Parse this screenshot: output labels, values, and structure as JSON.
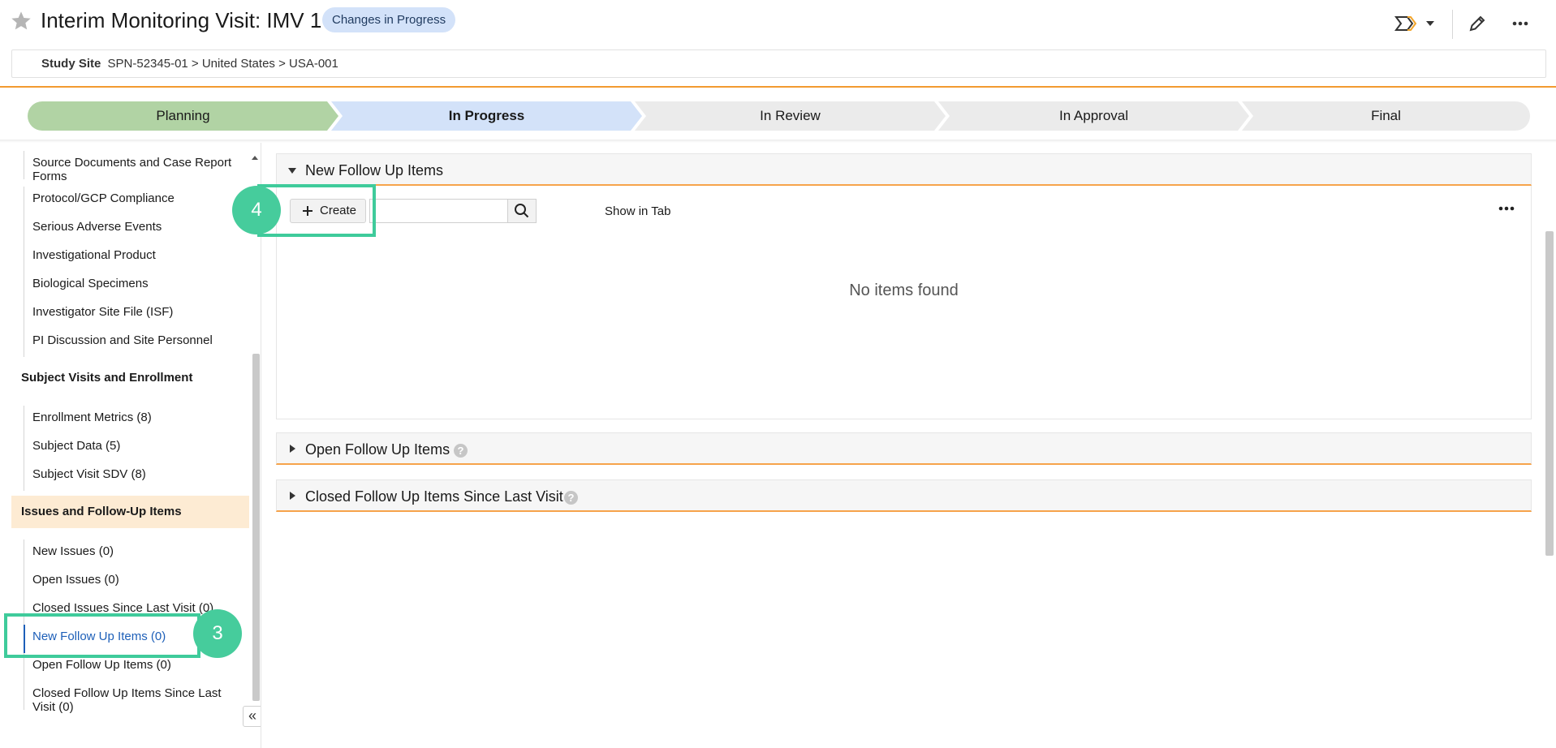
{
  "header": {
    "title": "Interim Monitoring Visit: IMV 1",
    "status_badge": "Changes in Progress",
    "breadcrumb_label": "Study Site",
    "breadcrumb_path": "SPN-52345-01 > United States > USA-001"
  },
  "stages": [
    {
      "label": "Planning",
      "state": "complete",
      "color": "#b1d3a4"
    },
    {
      "label": "In Progress",
      "state": "current",
      "color": "#d3e2f9"
    },
    {
      "label": "In Review",
      "state": "pending",
      "color": "#ebebeb"
    },
    {
      "label": "In Approval",
      "state": "pending",
      "color": "#ebebeb"
    },
    {
      "label": "Final",
      "state": "pending",
      "color": "#ebebeb"
    }
  ],
  "sidebar": {
    "items_top": [
      "Source Documents and Case Report Forms",
      "Protocol/GCP Compliance",
      "Serious Adverse Events",
      "Investigational Product",
      "Biological Specimens",
      "Investigator Site File (ISF)",
      "PI Discussion and Site Personnel"
    ],
    "section_subject": "Subject Visits and Enrollment",
    "items_subject": [
      "Enrollment Metrics (8)",
      "Subject Data (5)",
      "Subject Visit SDV (8)"
    ],
    "section_issues": "Issues and Follow-Up Items",
    "items_issues": [
      "New Issues (0)",
      "Open Issues (0)",
      "Closed Issues Since Last Visit (0)",
      "New Follow Up Items (0)",
      "Open Follow Up Items (0)",
      "Closed Follow Up Items Since Last Visit (0)"
    ],
    "collapse_glyph": "«"
  },
  "main": {
    "panel_new": {
      "title": "New Follow Up Items",
      "create_label": "Create",
      "search_placeholder": "",
      "show_in_tab": "Show in Tab",
      "empty_text": "No items found"
    },
    "panel_open": {
      "title": "Open Follow Up Items"
    },
    "panel_closed": {
      "title": "Closed Follow Up Items Since Last Visit"
    }
  },
  "callouts": {
    "step3": "3",
    "step4": "4"
  },
  "colors": {
    "accent_blue": "#1d5fb8",
    "orange": "#f29a30",
    "callout_green": "#46cc9c"
  }
}
